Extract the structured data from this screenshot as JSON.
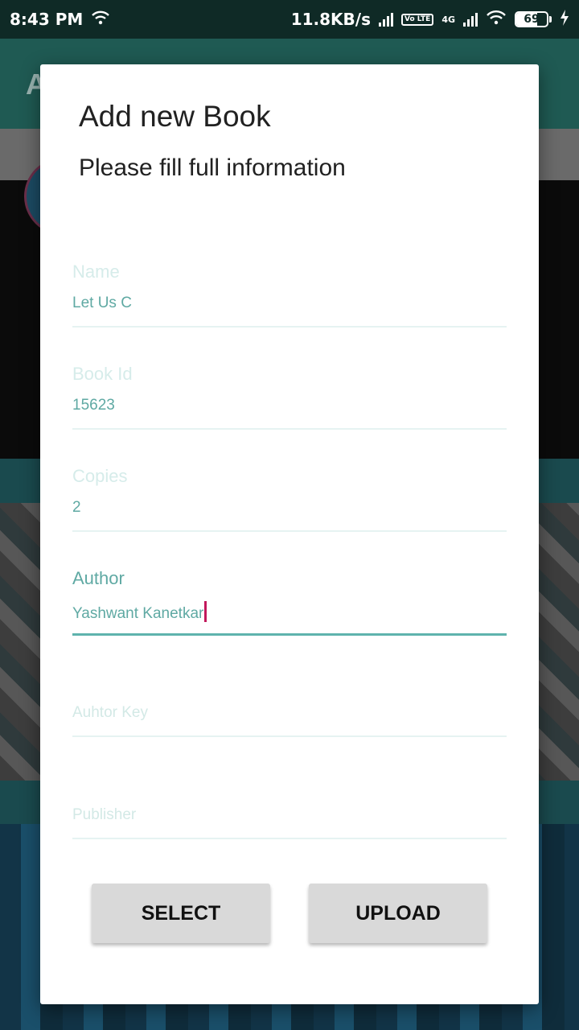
{
  "status_bar": {
    "time": "8:43 PM",
    "network_speed": "11.8KB/s",
    "volte_badge": "Vo LTE",
    "network_type": "4G",
    "battery_level": "69",
    "icons": [
      "wifi-icon",
      "signal-icon",
      "charging-icon"
    ]
  },
  "background_app": {
    "title_initial": "A"
  },
  "dialog": {
    "title": "Add new Book",
    "subtitle": "Please fill full information",
    "fields": [
      {
        "label": "Name",
        "value": "Let Us C"
      },
      {
        "label": "Book Id",
        "value": "15623"
      },
      {
        "label": "Copies",
        "value": "2"
      },
      {
        "label": "Author",
        "value": "Yashwant Kanetkar",
        "focused": true
      },
      {
        "placeholder": "Auhtor Key",
        "value": ""
      },
      {
        "placeholder": "Publisher",
        "value": ""
      }
    ],
    "buttons": {
      "select": "SELECT",
      "upload": "UPLOAD"
    }
  },
  "colors": {
    "accent": "#5fb3ad",
    "caret": "#c2185b",
    "status_bar": "#0f2a26"
  }
}
